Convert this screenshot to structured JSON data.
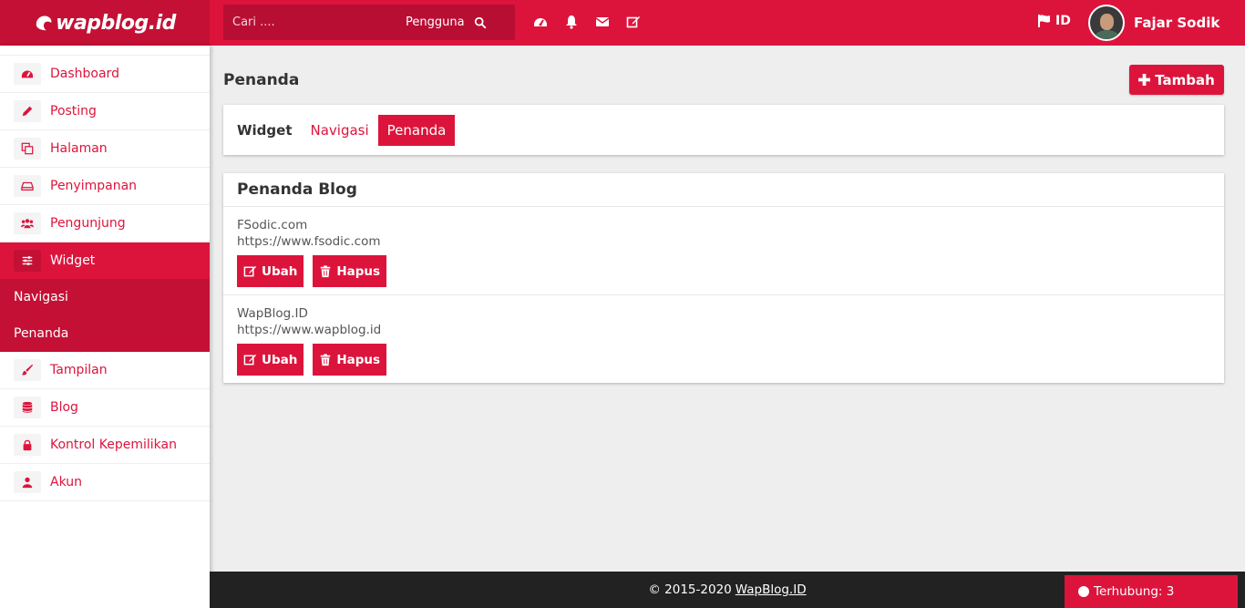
{
  "brand": {
    "logo_text": "wapblog.id"
  },
  "topbar": {
    "search_placeholder": "Cari ....",
    "search_scope": "Pengguna",
    "icons": [
      "dashboard-icon",
      "bell-icon",
      "envelope-icon",
      "edit-icon"
    ],
    "language": "ID",
    "user_name": "Fajar Sodik"
  },
  "sidebar": {
    "items": [
      {
        "label": "Dashboard",
        "icon": "dashboard-icon"
      },
      {
        "label": "Posting",
        "icon": "pencil-icon"
      },
      {
        "label": "Halaman",
        "icon": "copy-icon"
      },
      {
        "label": "Penyimpanan",
        "icon": "drive-icon"
      },
      {
        "label": "Pengunjung",
        "icon": "users-icon"
      },
      {
        "label": "Widget",
        "icon": "sliders-icon",
        "active": true
      },
      {
        "label": "Tampilan",
        "icon": "brush-icon"
      },
      {
        "label": "Blog",
        "icon": "database-icon"
      },
      {
        "label": "Kontrol Kepemilikan",
        "icon": "lock-icon"
      },
      {
        "label": "Akun",
        "icon": "user-icon"
      }
    ],
    "sub_items": [
      {
        "label": "Navigasi"
      },
      {
        "label": "Penanda"
      }
    ]
  },
  "main": {
    "title": "Penanda",
    "add_button": "Tambah",
    "tabs": [
      {
        "label": "Widget"
      },
      {
        "label": "Navigasi"
      },
      {
        "label": "Penanda"
      }
    ],
    "list_title": "Penanda Blog",
    "entries": [
      {
        "name": "FSodic.com",
        "url": "https://www.fsodic.com",
        "edit": "Ubah",
        "delete": "Hapus"
      },
      {
        "name": "WapBlog.ID",
        "url": "https://www.wapblog.id",
        "edit": "Ubah",
        "delete": "Hapus"
      }
    ]
  },
  "footer": {
    "copyright": "© 2015-2020",
    "link": "WapBlog.ID"
  },
  "status": {
    "label": "Terhubung: 3"
  },
  "colors": {
    "accent": "#dc143c",
    "accent_dark": "#c41035",
    "footer": "#222222",
    "background": "#eeeeee"
  }
}
